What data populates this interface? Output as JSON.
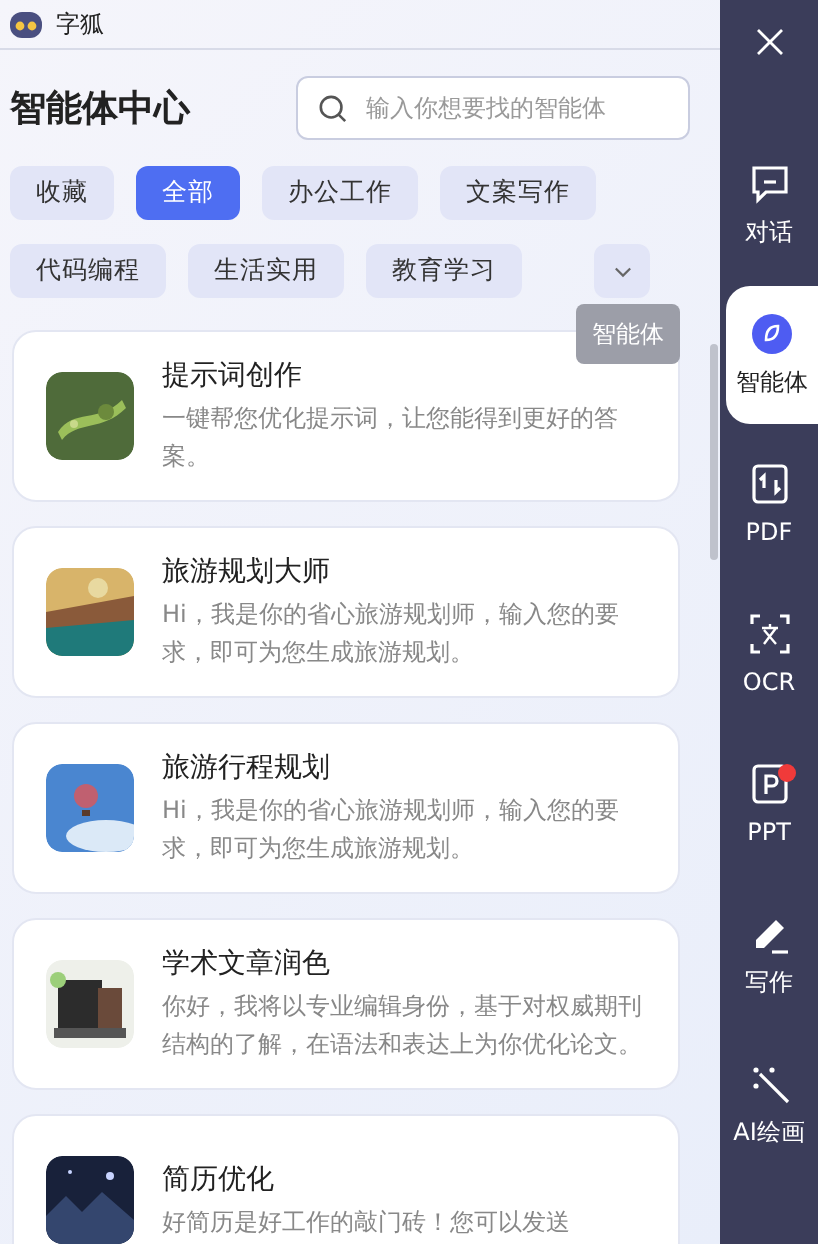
{
  "app": {
    "title": "字狐"
  },
  "header": {
    "title": "智能体中心",
    "search": {
      "placeholder": "输入你想要找的智能体"
    }
  },
  "categories": [
    {
      "label": "收藏",
      "selected": false
    },
    {
      "label": "全部",
      "selected": true
    },
    {
      "label": "办公工作",
      "selected": false
    },
    {
      "label": "文案写作",
      "selected": false
    },
    {
      "label": "代码编程",
      "selected": false
    },
    {
      "label": "生活实用",
      "selected": false
    },
    {
      "label": "教育学习",
      "selected": false
    }
  ],
  "agents": [
    {
      "title": "提示词创作",
      "description": "一键帮您优化提示词，让您能得到更好的答案。",
      "kind": "plant"
    },
    {
      "title": "旅游规划大师",
      "description": "Hi，我是你的省心旅游规划师，输入您的要求，即可为您生成旅游规划。",
      "kind": "map"
    },
    {
      "title": "旅游行程规划",
      "description": "Hi，我是你的省心旅游规划师，输入您的要求，即可为您生成旅游规划。",
      "kind": "balloon"
    },
    {
      "title": "学术文章润色",
      "description": "你好，我将以专业编辑身份，基于对权威期刊结构的了解，在语法和表达上为你优化论文。",
      "kind": "desk"
    },
    {
      "title": "简历优化",
      "description": "好简历是好工作的敲门砖！您可以发送",
      "kind": "night"
    }
  ],
  "sidebar": {
    "items": [
      {
        "label": "对话",
        "kind": "chat",
        "selected": false,
        "badge": false
      },
      {
        "label": "智能体",
        "kind": "agent",
        "selected": true,
        "badge": false
      },
      {
        "label": "PDF",
        "kind": "pdf",
        "selected": false,
        "badge": false
      },
      {
        "label": "OCR",
        "kind": "ocr",
        "selected": false,
        "badge": false
      },
      {
        "label": "PPT",
        "kind": "ppt",
        "selected": false,
        "badge": true
      },
      {
        "label": "写作",
        "kind": "write",
        "selected": false,
        "badge": false
      },
      {
        "label": "AI绘画",
        "kind": "paint",
        "selected": false,
        "badge": false
      }
    ]
  },
  "tooltip": {
    "text": "智能体"
  }
}
